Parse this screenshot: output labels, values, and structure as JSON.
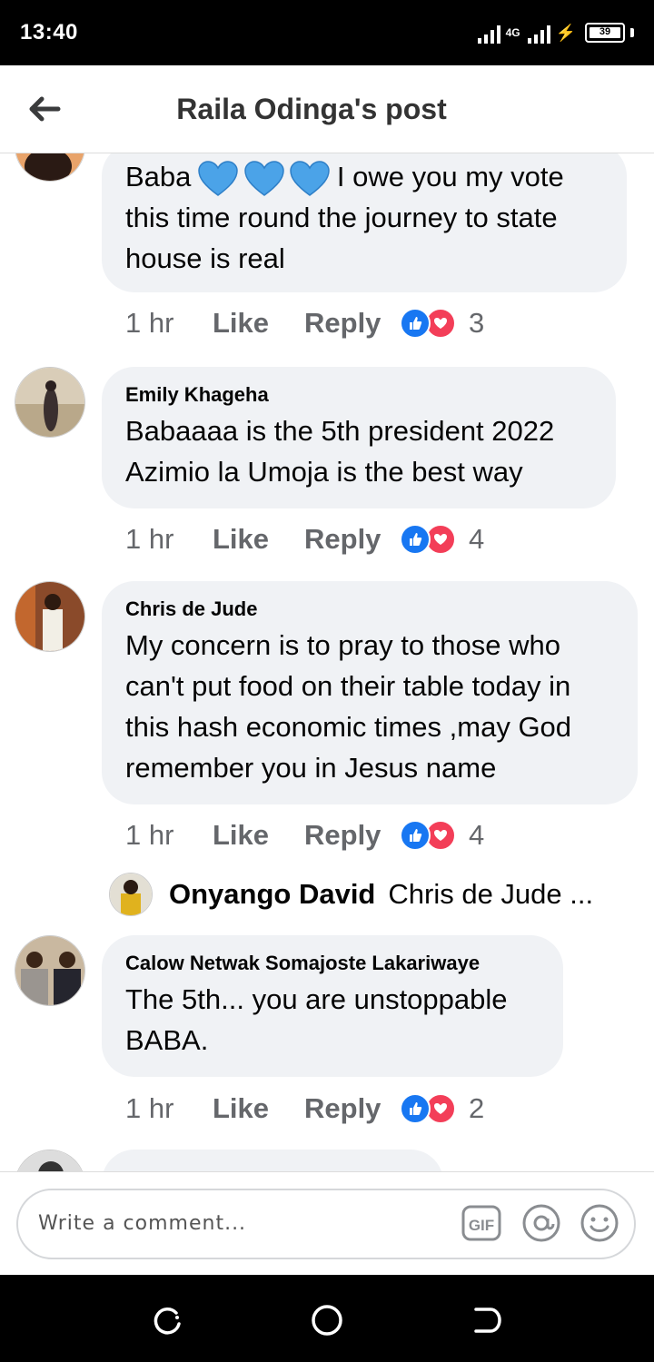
{
  "status_bar": {
    "time": "13:40",
    "network": "4G",
    "battery": "39"
  },
  "header": {
    "title": "Raila Odinga's post"
  },
  "comments": [
    {
      "author": "",
      "lines": [
        "I owe you my vote",
        "this time round the journey to state",
        "house is real"
      ],
      "prefix": "Baba",
      "time": "1 hr",
      "like": "Like",
      "reply": "Reply",
      "reaction_count": "3"
    },
    {
      "author": "Emily Khageha",
      "lines": [
        "Babaaaa is the 5th president 2022",
        "Azimio la Umoja is the best way"
      ],
      "time": "1 hr",
      "like": "Like",
      "reply": "Reply",
      "reaction_count": "4"
    },
    {
      "author": "Chris de Jude",
      "lines": [
        "My concern is to pray to those who",
        "can't put food on their table today in",
        "this hash economic times ,may God",
        "remember you in Jesus name"
      ],
      "time": "1 hr",
      "like": "Like",
      "reply": "Reply",
      "reaction_count": "4",
      "reply_preview": {
        "name": "Onyango David",
        "text": "Chris de Jude ..."
      }
    },
    {
      "author": "Calow Netwak Somajoste Lakariwaye",
      "lines": [
        "The 5th... you are unstoppable",
        "BABA."
      ],
      "time": "1 hr",
      "like": "Like",
      "reply": "Reply",
      "reaction_count": "2"
    }
  ],
  "composer": {
    "placeholder": "Write a comment...",
    "gif": "GIF"
  },
  "colors": {
    "like_blue": "#1877f2",
    "love_red": "#f33e58",
    "heart_emoji": "#4ba3e8",
    "bubble": "#f0f2f5"
  }
}
